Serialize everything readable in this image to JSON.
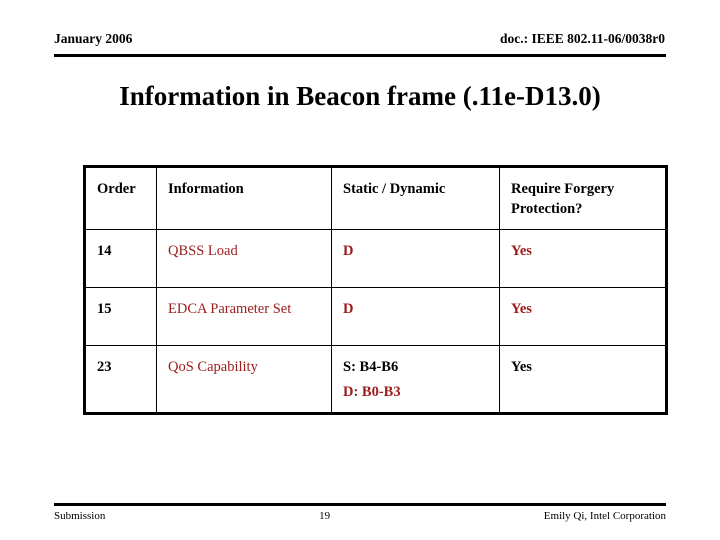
{
  "header": {
    "left": "January 2006",
    "right": "doc.: IEEE 802.11-06/0038r0"
  },
  "title": "Information in Beacon frame (.11e-D13.0)",
  "table": {
    "columns": [
      "Order",
      "Information",
      "Static / Dynamic",
      "Require Forgery Protection?"
    ],
    "rows": [
      {
        "order": "14",
        "information": "QBSS Load",
        "static_dynamic": "D",
        "static_dynamic_line2": "",
        "forgery_protection": "Yes"
      },
      {
        "order": "15",
        "information": "EDCA Parameter Set",
        "static_dynamic": "D",
        "static_dynamic_line2": "",
        "forgery_protection": "Yes"
      },
      {
        "order": "23",
        "information": "QoS Capability",
        "static_dynamic": "S: B4-B6",
        "static_dynamic_line2": "D: B0-B3",
        "forgery_protection": "Yes"
      }
    ]
  },
  "footer": {
    "left": "Submission",
    "page": "19",
    "right": "Emily Qi, Intel Corporation"
  },
  "colors": {
    "red": "#9C1B1B",
    "black": "#000000",
    "background": "#FFFFFF"
  }
}
